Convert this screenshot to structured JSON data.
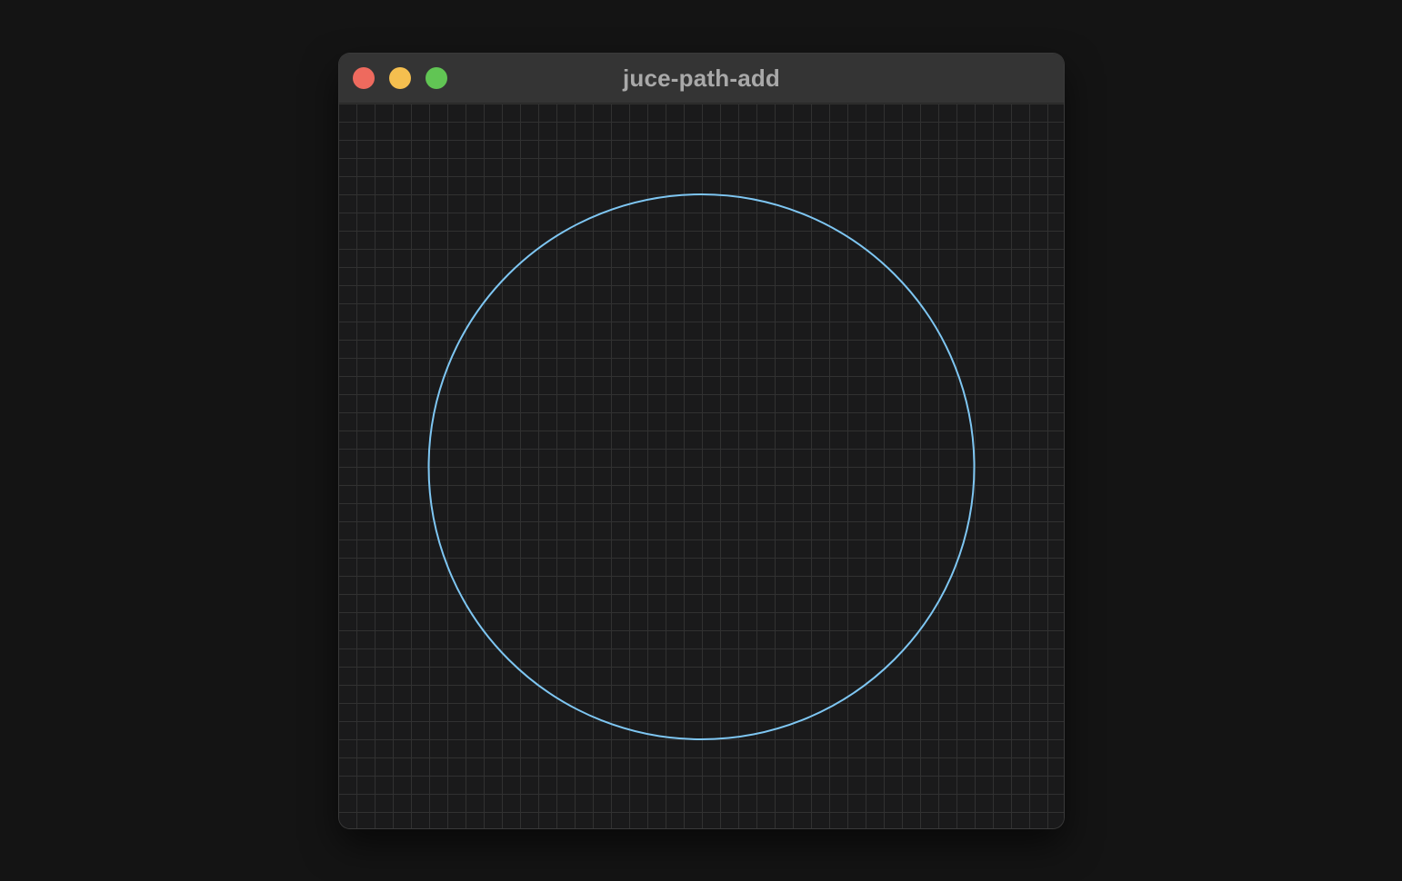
{
  "window": {
    "title": "juce-path-add"
  },
  "traffic_lights": {
    "close": {
      "label": "close",
      "color": "#ee6a5e"
    },
    "minimize": {
      "label": "minimize",
      "color": "#f5bf4f"
    },
    "zoom": {
      "label": "zoom",
      "color": "#61c554"
    }
  },
  "canvas": {
    "background_color": "#1a1a1b",
    "grid_color": "#313131",
    "grid": true,
    "shapes": [
      {
        "type": "circle-outline",
        "stroke_color": "#7ec6f2"
      }
    ]
  }
}
